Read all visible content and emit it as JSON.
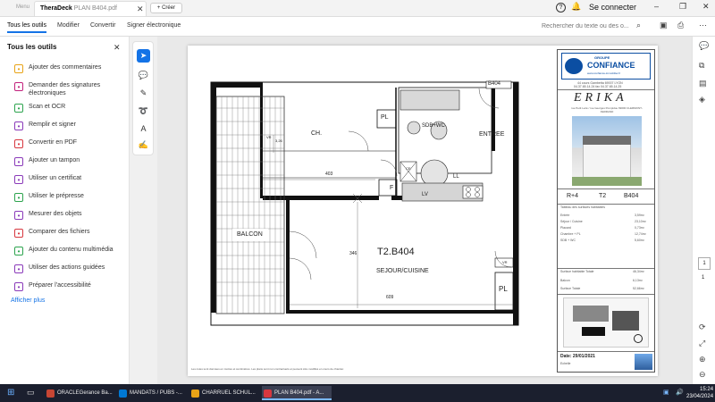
{
  "titlebar": {
    "menu": "Menu",
    "tab_title": "PLAN B404.pdf",
    "tab_overlay": "TheraDeck",
    "new_button": "+ Créer",
    "help_icon": "?",
    "login": "Se connecter",
    "minimize": "–",
    "maximize": "❐",
    "close": "✕"
  },
  "toolbar": {
    "tabs": [
      "Tous les outils",
      "Modifier",
      "Convertir",
      "Signer électronique"
    ],
    "search_placeholder": "Rechercher du texte ou des o..."
  },
  "tools_panel": {
    "title": "Tous les outils",
    "items": [
      {
        "label": "Ajouter des commentaires",
        "color": "#e8a317",
        "icon": "comment-icon"
      },
      {
        "label": "Demander des signatures électroniques",
        "color": "#c2217c",
        "icon": "signature-request-icon"
      },
      {
        "label": "Scan et OCR",
        "color": "#2da44e",
        "icon": "scan-icon"
      },
      {
        "label": "Remplir et signer",
        "color": "#8a3ab9",
        "icon": "fill-sign-icon"
      },
      {
        "label": "Convertir en PDF",
        "color": "#d7373f",
        "icon": "convert-pdf-icon"
      },
      {
        "label": "Ajouter un tampon",
        "color": "#8a3ab9",
        "icon": "stamp-icon"
      },
      {
        "label": "Utiliser un certificat",
        "color": "#8a3ab9",
        "icon": "certificate-icon"
      },
      {
        "label": "Utiliser le prépresse",
        "color": "#2da44e",
        "icon": "prepress-icon"
      },
      {
        "label": "Mesurer des objets",
        "color": "#8a3ab9",
        "icon": "ruler-icon"
      },
      {
        "label": "Comparer des fichiers",
        "color": "#d7373f",
        "icon": "compare-icon"
      },
      {
        "label": "Ajouter du contenu multimédia",
        "color": "#2da44e",
        "icon": "media-icon"
      },
      {
        "label": "Utiliser des actions guidées",
        "color": "#8a3ab9",
        "icon": "guided-actions-icon"
      },
      {
        "label": "Préparer l'accessibilité",
        "color": "#8a3ab9",
        "icon": "accessibility-icon"
      }
    ],
    "show_more": "Afficher plus"
  },
  "plan": {
    "unit_code_top": "B404",
    "rooms": {
      "bedroom": "CH.",
      "bathroom": "SDB+WC",
      "entry": "ENTREE",
      "balcony": "BALCON",
      "unit": "T2.B404",
      "living": "SEJOUR/CUISINE",
      "pl_small": "PL",
      "pl_big": "PL",
      "f": "F",
      "ll": "LL",
      "lv": "LV",
      "ce": "CE",
      "vr1": "VR",
      "vr2": "VR"
    },
    "dims": {
      "d1": "403",
      "d2": "3,26",
      "d3": "346",
      "d4": "609"
    },
    "footer_note": "Les cotes sont données en mètres et centimètres. Les plans sont non contractuels et peuvent être modifiés en cours de chantier."
  },
  "titleblock": {
    "company_top": "GROUPE",
    "company": "CONFIANCE",
    "website": "www.confiance-immobilier.fr",
    "address": "44 cours Gambetta 69007 LYON",
    "phone": "04.37.65.14.24  fax 04.37.65.14.25",
    "project": "ERIKA",
    "project_address": "rue Petit Lezé / rue Georges Pompidou 69000 CLERMONT-FERRAND",
    "level": "R+4",
    "type": "T2",
    "lot": "B404",
    "table_title": "Tableau des surfaces habitables",
    "rows": [
      {
        "label": "Entrée",
        "value": "3,59m²"
      },
      {
        "label": "Séjour / Cuisine",
        "value": "23,10m²"
      },
      {
        "label": "Placard",
        "value": "0,73m²"
      },
      {
        "label": "Chambre + PL",
        "value": "12,74m²"
      },
      {
        "label": "SDB + WC",
        "value": "5,60m²"
      }
    ],
    "total_label": "Surface habitable Totale",
    "total_value": "46,34m²",
    "balcony_label": "Balcon",
    "balcony_value": "6,13m²",
    "total2_label": "Surface Totale",
    "total2_value": "52,66m²",
    "date_label": "Date: 29/01/2021",
    "echelle": "Echelle"
  },
  "rightbar": {
    "page_current": "1",
    "page_total": "1"
  },
  "taskbar": {
    "apps": [
      {
        "label": "ORACLEGerance Ba...",
        "color": "#c74634"
      },
      {
        "label": "MANDATS / PUBS -...",
        "color": "#0078d4"
      },
      {
        "label": "CHARRUEL SCHUL...",
        "color": "#e8a317"
      },
      {
        "label": "PLAN B404.pdf - A...",
        "color": "#d7373f"
      }
    ],
    "time": "15:24",
    "date": "23/04/2024"
  }
}
